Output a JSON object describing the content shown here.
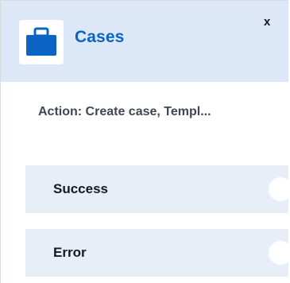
{
  "block": {
    "title": "Cases",
    "icon": "briefcase-icon",
    "close_label": "x",
    "action_summary": "Action: Create case, Templ...",
    "branches": [
      {
        "label": "Success"
      },
      {
        "label": "Error"
      }
    ]
  },
  "colors": {
    "header_background": "#dce8f7",
    "title_color": "#0b63c4",
    "icon_color": "#0b63c4",
    "branch_background": "#e7eef8"
  }
}
